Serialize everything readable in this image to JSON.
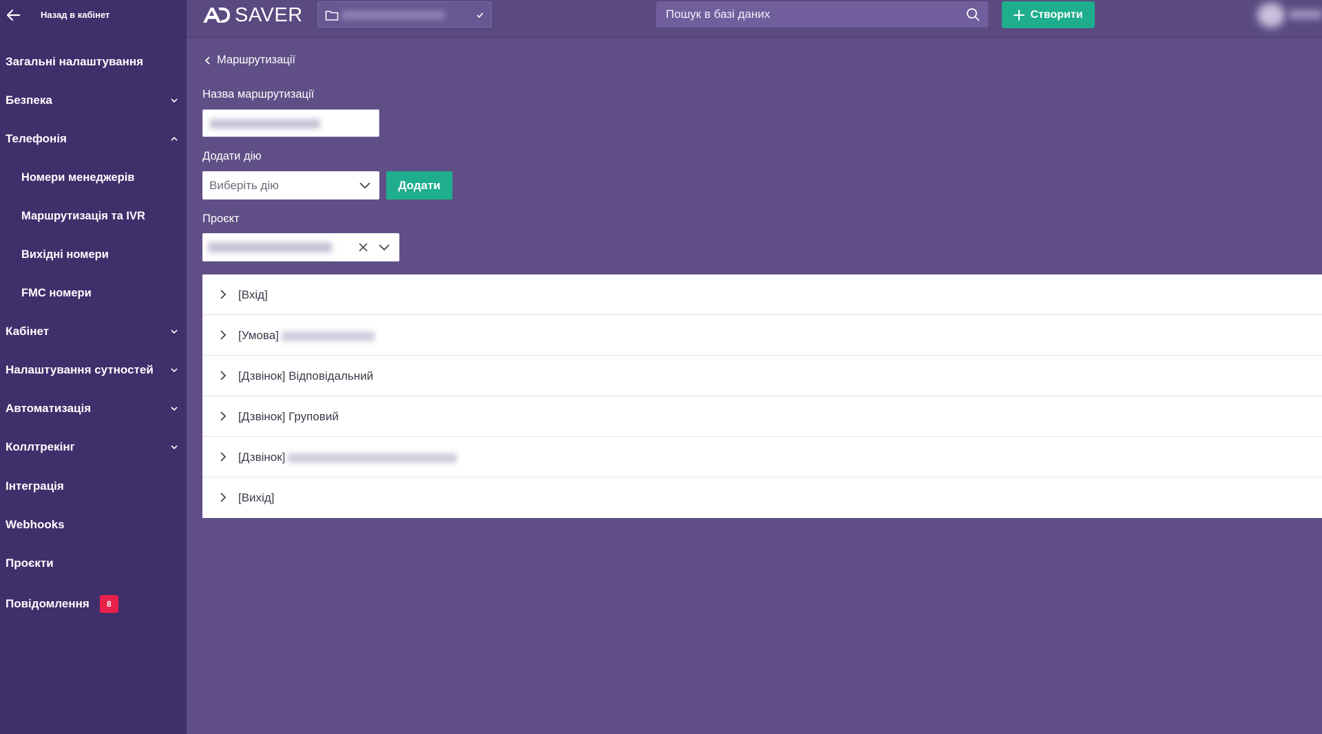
{
  "sidebar": {
    "back_label": "Назад в кабінет",
    "items": [
      {
        "label": "Загальні налаштування",
        "chevron": "none"
      },
      {
        "label": "Безпека",
        "chevron": "down"
      },
      {
        "label": "Телефонія",
        "chevron": "up"
      },
      {
        "label": "Номери менеджерів",
        "sub": true
      },
      {
        "label": "Маршрутизація та IVR",
        "sub": true
      },
      {
        "label": "Вихідні номери",
        "sub": true
      },
      {
        "label": "FMC номери",
        "sub": true
      },
      {
        "label": "Кабінет",
        "chevron": "down"
      },
      {
        "label": "Налаштування сутностей",
        "chevron": "down"
      },
      {
        "label": "Автоматизація",
        "chevron": "down"
      },
      {
        "label": "Коллтрекінг",
        "chevron": "down"
      },
      {
        "label": "Інтеграція",
        "chevron": "none"
      },
      {
        "label": "Webhooks",
        "chevron": "none"
      },
      {
        "label": "Проєкти",
        "chevron": "none"
      },
      {
        "label": "Повідомлення",
        "badge": "8"
      }
    ]
  },
  "topbar": {
    "logo_text": "SAVER",
    "search_placeholder": "Пошук в базі даних",
    "create_label": "Створити"
  },
  "content": {
    "breadcrumb": "Маршрутизації",
    "name_label": "Назва маршрутизації",
    "add_action_label": "Додати дію",
    "action_placeholder": "Виберіть дію",
    "add_button": "Додати",
    "project_label": "Проєкт",
    "steps": [
      {
        "label": "[Вхід]"
      },
      {
        "label": "[Умова]"
      },
      {
        "label": "[Дзвінок] Відповідальний"
      },
      {
        "label": "[Дзвінок] Груповий"
      },
      {
        "label": "[Дзвінок]"
      },
      {
        "label": "[Вихід]"
      }
    ]
  },
  "colors": {
    "sidebar_bg": "#3f2f6b",
    "page_bg": "#5f4f86",
    "accent_green": "#1fae8d",
    "badge_red": "#e8204a"
  }
}
